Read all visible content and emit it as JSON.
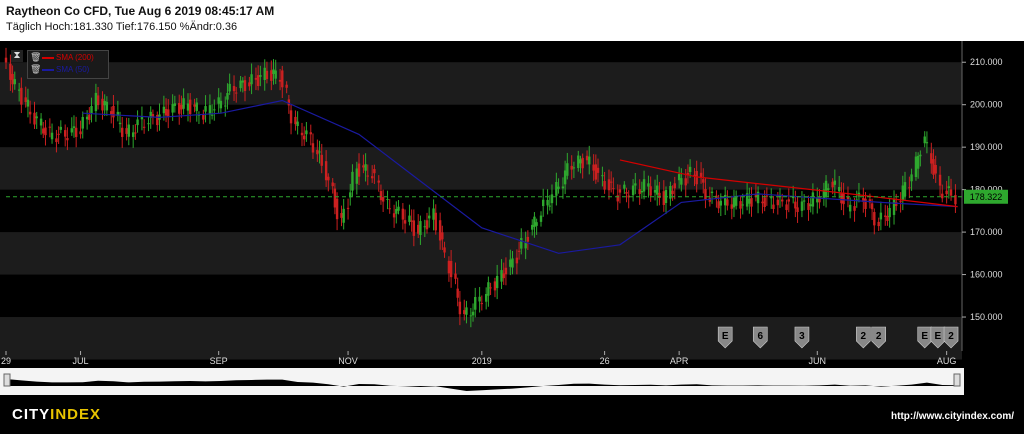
{
  "header": {
    "title": "Raytheon Co CFD, Tue Aug 6 2019 08:45:17 AM",
    "subtitle": "Täglich Hoch:181.330 Tief:176.150 %Ändr:0.36"
  },
  "legend": {
    "items": [
      {
        "label": "SMA (200)",
        "color": "#d40000"
      },
      {
        "label": "SMA (50)",
        "color": "#1a1aa0"
      }
    ]
  },
  "price_tag": "178.322",
  "footer": {
    "brand_part1": "CITY",
    "brand_part2": "INDEX",
    "url": "http://www.cityindex.com/"
  },
  "event_markers": [
    "E",
    "6",
    "3",
    "2",
    "2",
    "E",
    "E",
    "2"
  ],
  "colors": {
    "background": "#000000",
    "band": "#1c1c1c",
    "up_candle": "#2ea82e",
    "down_candle": "#cc2020",
    "sma200": "#d40000",
    "sma50": "#1a1aa0",
    "current_price_line": "#2ea82e",
    "brand_accent": "#e8c400"
  },
  "chart_data": {
    "type": "line",
    "title": "Raytheon Co CFD",
    "subtitle": "Täglich Hoch:181.330 Tief:176.150 %Ändr:0.36",
    "ylim": [
      142,
      215
    ],
    "y_ticks": [
      "150.000",
      "160.000",
      "170.000",
      "180.000",
      "190.000",
      "200.000",
      "210.000"
    ],
    "x_ticks": [
      "29",
      "JUL",
      "SEP",
      "NOV",
      "2019",
      "26",
      "APR",
      "JUN",
      "AUG"
    ],
    "current_price": 178.322,
    "close_series": [
      {
        "date": "2018-05-29",
        "close": 210
      },
      {
        "date": "2018-06-05",
        "close": 203
      },
      {
        "date": "2018-06-12",
        "close": 197
      },
      {
        "date": "2018-06-19",
        "close": 193
      },
      {
        "date": "2018-06-26",
        "close": 193
      },
      {
        "date": "2018-07-03",
        "close": 194
      },
      {
        "date": "2018-07-10",
        "close": 201
      },
      {
        "date": "2018-07-17",
        "close": 199
      },
      {
        "date": "2018-07-24",
        "close": 193
      },
      {
        "date": "2018-07-31",
        "close": 196
      },
      {
        "date": "2018-08-07",
        "close": 197
      },
      {
        "date": "2018-08-14",
        "close": 199
      },
      {
        "date": "2018-08-21",
        "close": 200
      },
      {
        "date": "2018-08-28",
        "close": 198
      },
      {
        "date": "2018-09-04",
        "close": 200
      },
      {
        "date": "2018-09-11",
        "close": 204
      },
      {
        "date": "2018-09-18",
        "close": 205
      },
      {
        "date": "2018-09-25",
        "close": 207
      },
      {
        "date": "2018-10-02",
        "close": 207
      },
      {
        "date": "2018-10-09",
        "close": 195
      },
      {
        "date": "2018-10-16",
        "close": 192
      },
      {
        "date": "2018-10-23",
        "close": 184
      },
      {
        "date": "2018-10-30",
        "close": 172
      },
      {
        "date": "2018-11-06",
        "close": 185
      },
      {
        "date": "2018-11-13",
        "close": 184
      },
      {
        "date": "2018-11-20",
        "close": 176
      },
      {
        "date": "2018-11-27",
        "close": 174
      },
      {
        "date": "2018-12-04",
        "close": 170
      },
      {
        "date": "2018-12-11",
        "close": 174
      },
      {
        "date": "2018-12-18",
        "close": 162
      },
      {
        "date": "2018-12-25",
        "close": 150
      },
      {
        "date": "2019-01-01",
        "close": 154
      },
      {
        "date": "2019-01-08",
        "close": 158
      },
      {
        "date": "2019-01-15",
        "close": 162
      },
      {
        "date": "2019-01-22",
        "close": 168
      },
      {
        "date": "2019-01-29",
        "close": 175
      },
      {
        "date": "2019-02-05",
        "close": 180
      },
      {
        "date": "2019-02-12",
        "close": 186
      },
      {
        "date": "2019-02-19",
        "close": 187
      },
      {
        "date": "2019-02-26",
        "close": 182
      },
      {
        "date": "2019-03-05",
        "close": 179
      },
      {
        "date": "2019-03-12",
        "close": 180
      },
      {
        "date": "2019-03-19",
        "close": 181
      },
      {
        "date": "2019-03-26",
        "close": 178
      },
      {
        "date": "2019-04-02",
        "close": 182
      },
      {
        "date": "2019-04-09",
        "close": 184
      },
      {
        "date": "2019-04-16",
        "close": 178
      },
      {
        "date": "2019-04-23",
        "close": 177
      },
      {
        "date": "2019-04-30",
        "close": 177
      },
      {
        "date": "2019-05-07",
        "close": 178
      },
      {
        "date": "2019-05-14",
        "close": 177
      },
      {
        "date": "2019-05-21",
        "close": 177
      },
      {
        "date": "2019-05-28",
        "close": 176
      },
      {
        "date": "2019-06-04",
        "close": 178
      },
      {
        "date": "2019-06-11",
        "close": 182
      },
      {
        "date": "2019-06-18",
        "close": 176
      },
      {
        "date": "2019-06-25",
        "close": 178
      },
      {
        "date": "2019-07-02",
        "close": 172
      },
      {
        "date": "2019-07-09",
        "close": 176
      },
      {
        "date": "2019-07-16",
        "close": 182
      },
      {
        "date": "2019-07-23",
        "close": 192
      },
      {
        "date": "2019-07-30",
        "close": 180
      },
      {
        "date": "2019-08-06",
        "close": 178.322
      }
    ],
    "series": [
      {
        "name": "SMA (50)",
        "points": [
          {
            "date": "2018-07-03",
            "value": 198
          },
          {
            "date": "2018-08-07",
            "value": 197
          },
          {
            "date": "2018-09-04",
            "value": 198
          },
          {
            "date": "2018-10-02",
            "value": 201
          },
          {
            "date": "2018-11-06",
            "value": 193
          },
          {
            "date": "2018-12-04",
            "value": 182
          },
          {
            "date": "2019-01-01",
            "value": 171
          },
          {
            "date": "2019-02-05",
            "value": 165
          },
          {
            "date": "2019-03-05",
            "value": 167
          },
          {
            "date": "2019-04-02",
            "value": 177
          },
          {
            "date": "2019-05-07",
            "value": 179
          },
          {
            "date": "2019-06-04",
            "value": 178
          },
          {
            "date": "2019-07-02",
            "value": 177
          },
          {
            "date": "2019-08-06",
            "value": 176
          }
        ]
      },
      {
        "name": "SMA (200)",
        "points": [
          {
            "date": "2019-03-05",
            "value": 187
          },
          {
            "date": "2019-04-09",
            "value": 183
          },
          {
            "date": "2019-05-14",
            "value": 181
          },
          {
            "date": "2019-06-18",
            "value": 179
          },
          {
            "date": "2019-08-06",
            "value": 176
          }
        ]
      }
    ]
  }
}
